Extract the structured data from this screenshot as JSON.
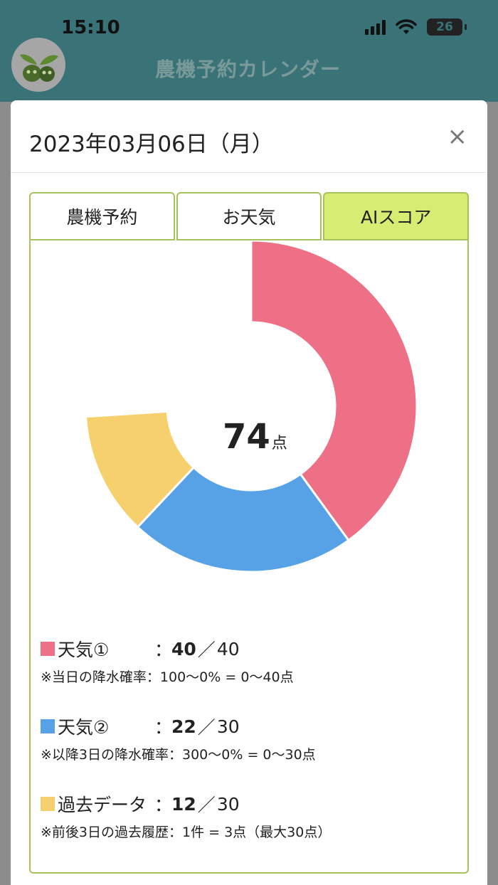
{
  "status": {
    "time": "15:10",
    "battery": "26"
  },
  "header": {
    "title": "農機予約カレンダー",
    "logo_icon": "sprout-logo-icon"
  },
  "modal": {
    "date": "2023年03月06日（月）",
    "close_label": "×",
    "tabs": [
      {
        "label": "農機予約",
        "active": false
      },
      {
        "label": "お天気",
        "active": false
      },
      {
        "label": "AIスコア",
        "active": true
      }
    ]
  },
  "chart_data": {
    "type": "pie",
    "max_total": 100,
    "total": {
      "value": "74",
      "unit": "点"
    },
    "series": [
      {
        "name": "天気①",
        "value": 40,
        "max": 40,
        "color": "#ee7087",
        "note": "※当日の降水確率：100〜0% = 0〜40点"
      },
      {
        "name": "天気②",
        "value": 22,
        "max": 30,
        "color": "#57a2e6",
        "note": "※以降3日の降水確率：300〜0% = 0〜30点"
      },
      {
        "name": "過去データ",
        "value": 12,
        "max": 30,
        "color": "#f6d06d",
        "note": "※前後3日の過去履歴：1件 = 3点（最大30点）"
      }
    ]
  },
  "legend_colon": "：",
  "legend_slash": "／"
}
